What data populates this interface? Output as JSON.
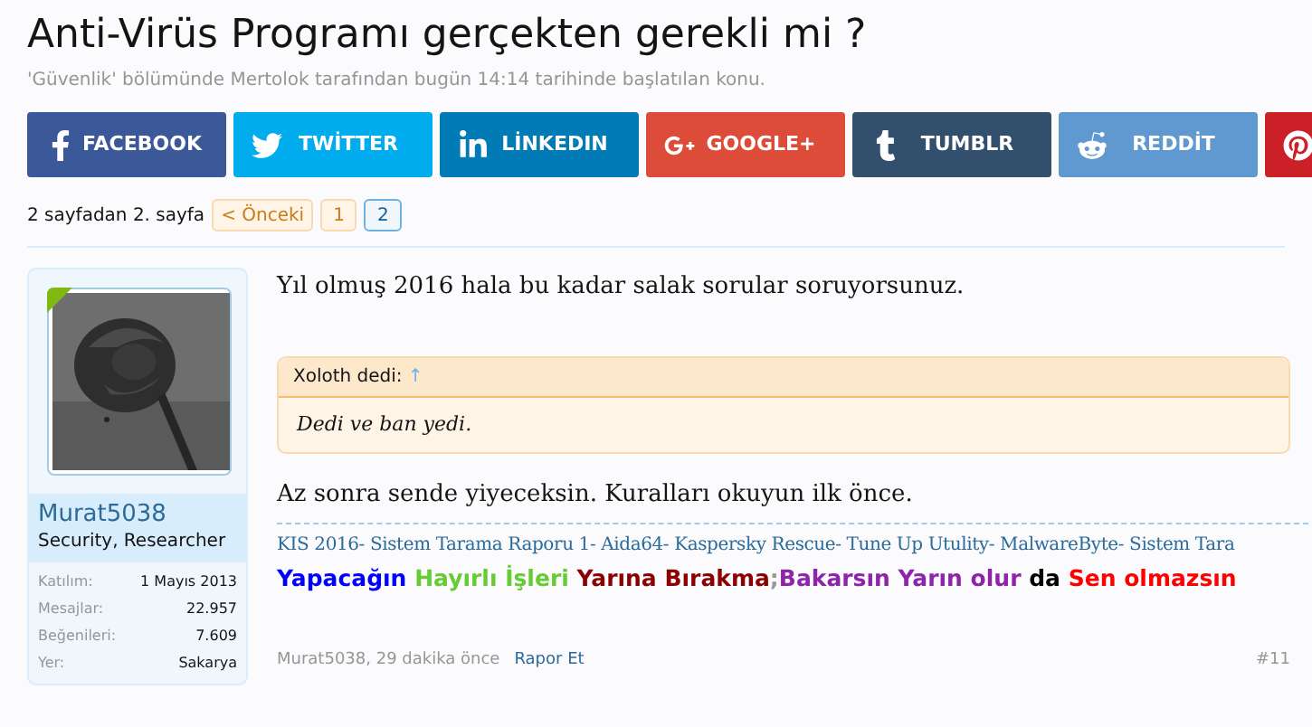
{
  "thread": {
    "title": "Anti-Virüs Programı gerçekten gerekli mi ?",
    "meta": "'Güvenlik' bölümünde Mertolok tarafından bugün 14:14 tarihinde başlatılan konu."
  },
  "share_buttons": [
    {
      "kind": "facebook",
      "label": "FACEBOOK",
      "color": "#3b5998"
    },
    {
      "kind": "twitter",
      "label": "TWİTTER",
      "color": "#00aced"
    },
    {
      "kind": "linkedin",
      "label": "LİNKEDIN",
      "color": "#007bb6"
    },
    {
      "kind": "google",
      "label": "GOOGLE+",
      "color": "#dd4b39"
    },
    {
      "kind": "tumblr",
      "label": "TUMBLR",
      "color": "#32506d"
    },
    {
      "kind": "reddit",
      "label": "REDDİT",
      "color": "#5f99cf"
    },
    {
      "kind": "pinterest",
      "color": "#cb2027"
    }
  ],
  "pagination": {
    "summary": "2 sayfadan 2. sayfa",
    "prev": "< Önceki",
    "pages": [
      {
        "label": "1",
        "selected": false
      },
      {
        "label": "2",
        "selected": true
      }
    ]
  },
  "post": {
    "author": {
      "name": "Murat5038",
      "title": "Security, Researcher",
      "stats": [
        {
          "label": "Katılım:",
          "value": "1 Mayıs 2013"
        },
        {
          "label": "Mesajlar:",
          "value": "22.957"
        },
        {
          "label": "Beğenileri:",
          "value": "7.609"
        },
        {
          "label": "Yer:",
          "value": "Sakarya"
        }
      ]
    },
    "paragraph_1": "Yıl olmuş 2016 hala bu kadar salak sorular soruyorsunuz.",
    "quote": {
      "author": "Xoloth dedi:",
      "arrow": "↑",
      "text": "Dedi ve ban yedi."
    },
    "paragraph_2": "Az sonra sende yiyeceksin. Kuralları okuyun ilk önce.",
    "signature_links": "KIS 2016- Sistem Tarama Raporu 1- Aida64- Kaspersky Rescue- Tune Up Utulity- MalwareByte- Sistem Tara",
    "signature_motto": [
      {
        "text": "Yapacağın ",
        "color": "#0000ff"
      },
      {
        "text": "Hayırlı İşleri ",
        "color": "#66cc33"
      },
      {
        "text": "Yarına Bırakma",
        "color": "#8b0000"
      },
      {
        "text": ";",
        "color": "#999999"
      },
      {
        "text": "Bakarsın Yarın olur ",
        "color": "#8e24aa"
      },
      {
        "text": "da ",
        "color": "#000000"
      },
      {
        "text": "Sen olmazsın",
        "color": "#ff0000"
      }
    ],
    "footer": {
      "byline": "Murat5038, 29 dakika önce",
      "report": "Rapor Et",
      "number": "#11"
    }
  }
}
